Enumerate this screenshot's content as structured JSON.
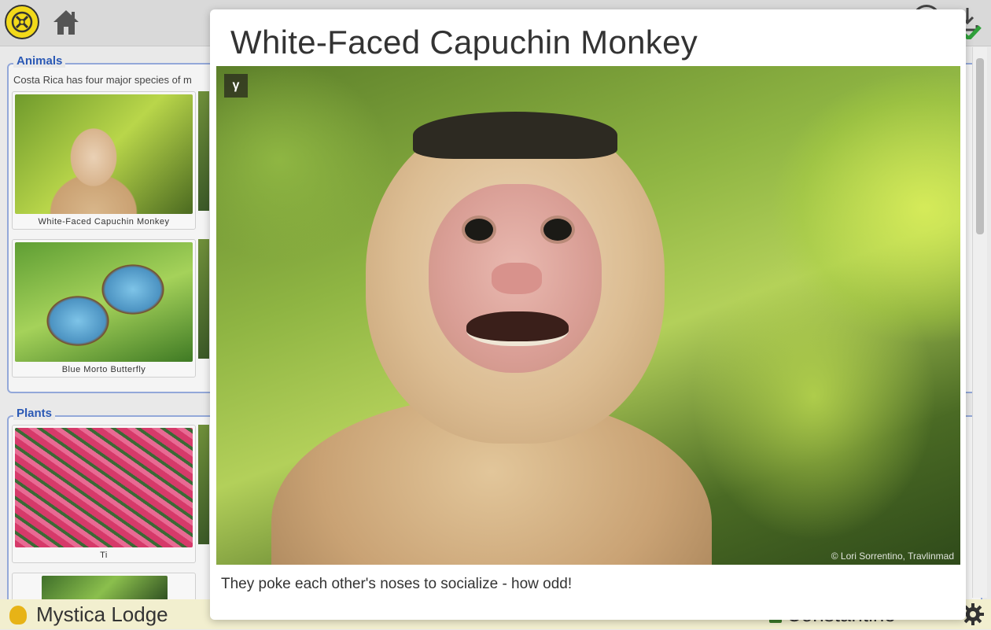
{
  "animals": {
    "title": "Animals",
    "description": "Costa Rica has four major species of m",
    "cards": [
      {
        "caption": "White-Faced Capuchin Monkey"
      },
      {
        "caption": "Blue Morto Butterfly"
      }
    ]
  },
  "plants": {
    "title": "Plants",
    "cards": [
      {
        "caption": "Ti"
      }
    ]
  },
  "footer": {
    "lodge_name": "Mystica Lodge",
    "user_name": "Constantine"
  },
  "modal": {
    "title": "White-Faced Capuchin Monkey",
    "badge": "γ",
    "photo_credit": "© Lori Sorrentino, Travlinmad",
    "caption": "They poke each other's noses to socialize - how odd!"
  },
  "icons": {
    "logo": "compass-logo-icon",
    "home": "home-icon",
    "globe": "globe-icon",
    "download": "download-icon",
    "check": "check-icon",
    "gear": "gear-icon"
  },
  "colors": {
    "accent": "#2b59b5",
    "logo_yellow": "#f2d91a",
    "footer_bg": "#f2efcf",
    "check_green": "#2fa03a"
  }
}
